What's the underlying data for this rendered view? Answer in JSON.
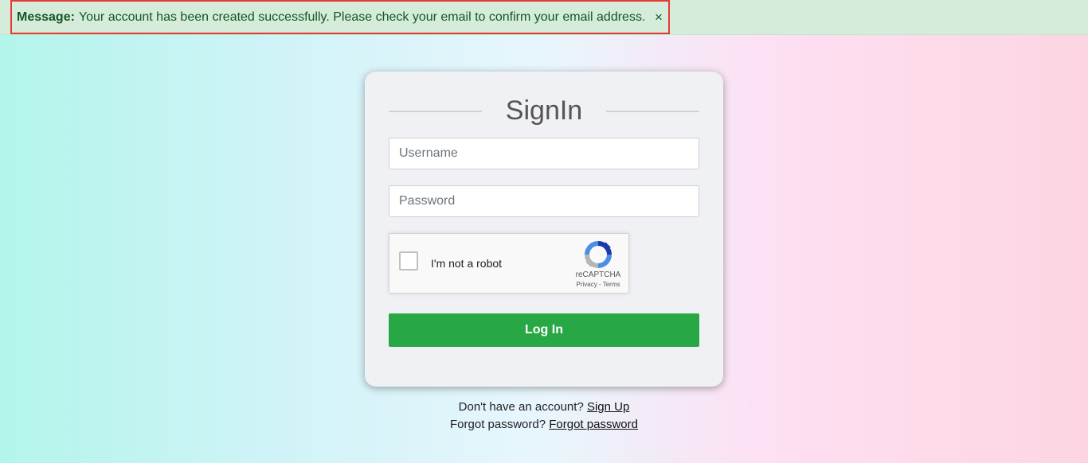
{
  "alert": {
    "title": "Message:",
    "text": "Your account has been created successfully. Please check your email to confirm your email address.",
    "close_label": "×"
  },
  "signin": {
    "title": "SignIn",
    "username_placeholder": "Username",
    "password_placeholder": "Password",
    "login_label": "Log In"
  },
  "recaptcha": {
    "label": "I'm not a robot",
    "brand": "reCAPTCHA",
    "privacy": "Privacy",
    "separator": "-",
    "terms": "Terms",
    "logo_icon": "recaptcha-logo-icon"
  },
  "footer": {
    "signup_prompt": "Don't have an account?",
    "signup_link": "Sign Up",
    "forgot_prompt": "Forgot password?",
    "forgot_link": "Forgot password"
  },
  "colors": {
    "alert_bg": "#d4ecd9",
    "alert_border": "#e53935",
    "alert_text": "#155724",
    "login_button": "#28a745"
  }
}
